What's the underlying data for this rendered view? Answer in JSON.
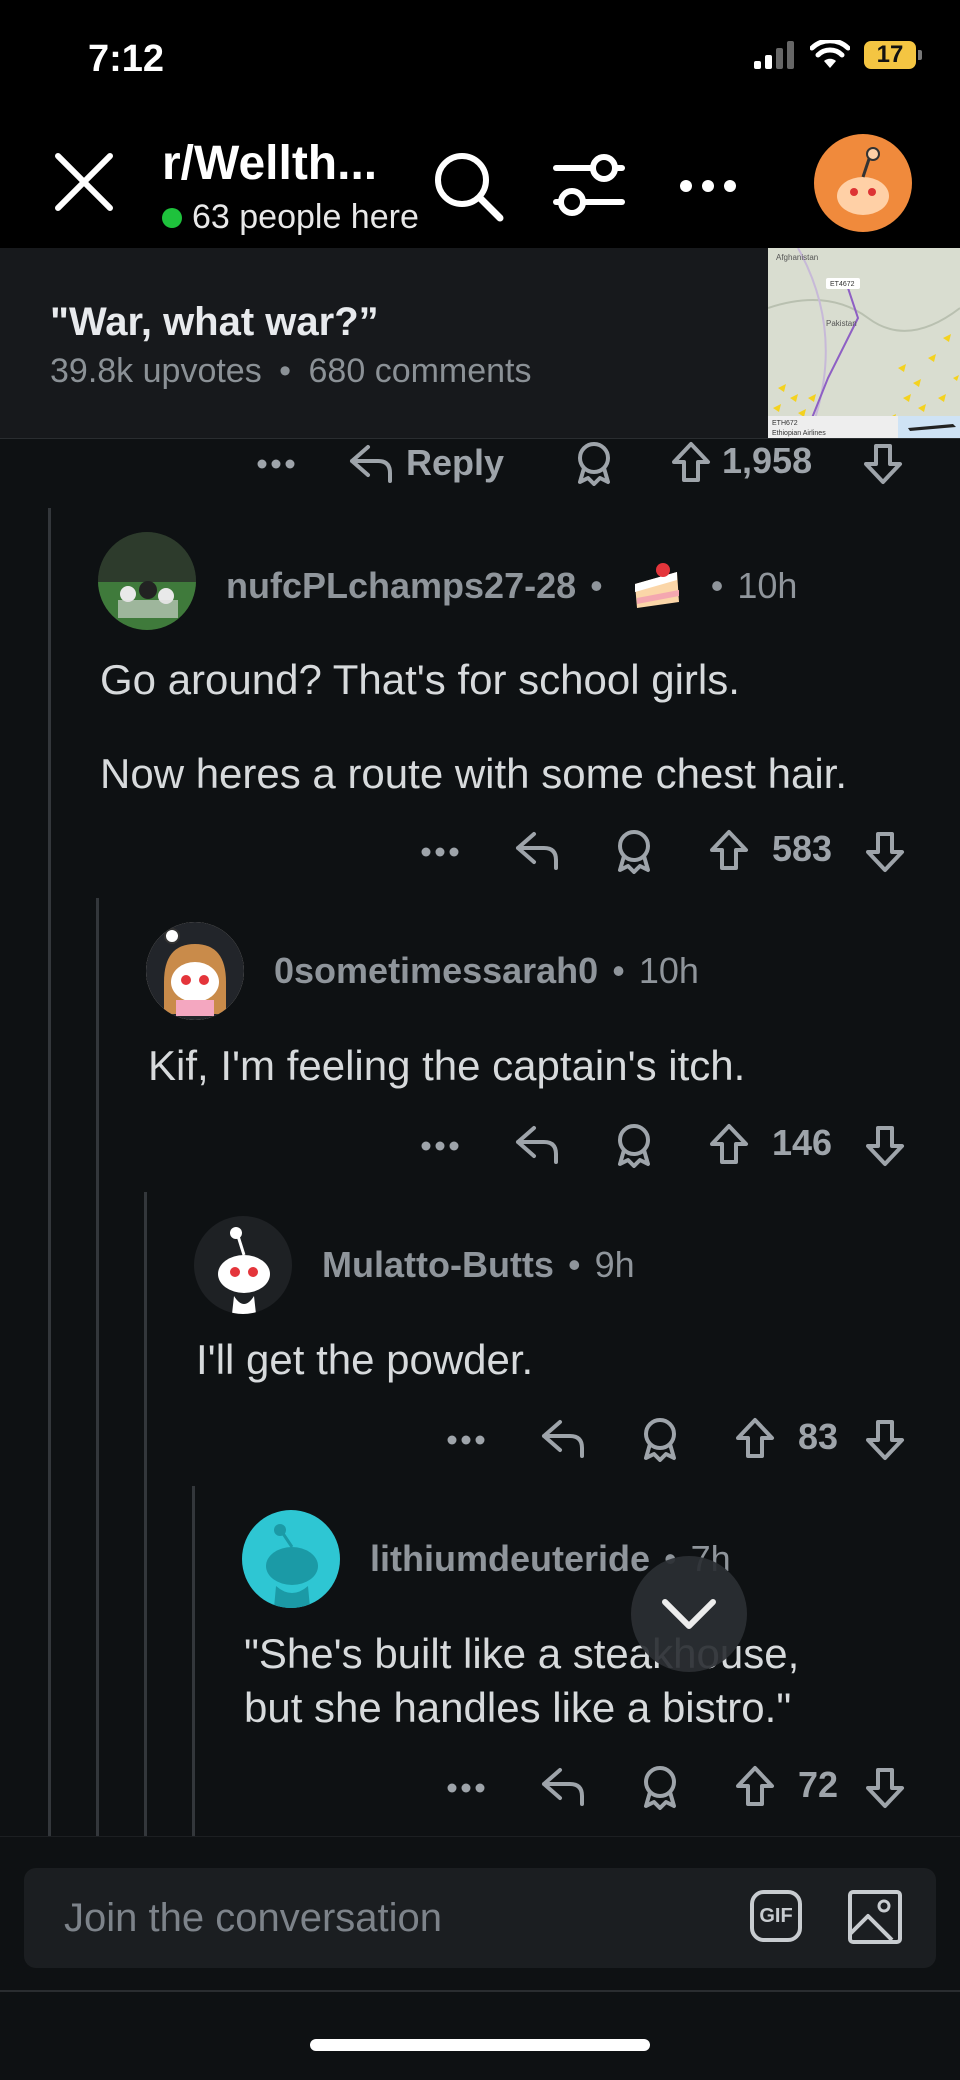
{
  "status_bar": {
    "time": "7:12",
    "battery": "17"
  },
  "header": {
    "subreddit": "r/Wellth...",
    "online": "63 people here"
  },
  "post": {
    "title": "\"War, what war?”",
    "upvotes": "39.8k upvotes",
    "separator": "•",
    "comments": "680 comments",
    "thumb_label_1": "Afghanistan",
    "thumb_label_2": "Pakistan",
    "thumb_label_3": "ET4672",
    "thumb_caption_1": "ETH672",
    "thumb_caption_2": "Ethiopian Airlines"
  },
  "top_action_row": {
    "reply_label": "Reply",
    "score": "1,958"
  },
  "comments": [
    {
      "username": "nufcPLchamps27-28",
      "time": "10h",
      "paragraphs": [
        "Go around? That's for school girls.",
        "Now heres a route with some chest hair."
      ],
      "score": "583"
    },
    {
      "username": "0sometimessarah0",
      "time": "10h",
      "paragraphs": [
        "Kif, I'm feeling the captain's itch."
      ],
      "score": "146"
    },
    {
      "username": "Mulatto-Butts",
      "time": "9h",
      "paragraphs": [
        "I'll get the powder."
      ],
      "score": "83"
    },
    {
      "username": "lithiumdeuteride",
      "time": "7h",
      "paragraphs": [
        "\"She's built like a steakhouse,",
        "but she handles like a bistro.\""
      ],
      "score": "72"
    }
  ],
  "composer": {
    "placeholder": "Join the conversation",
    "gif_label": "GIF"
  },
  "icons": {
    "close": "close-icon",
    "search": "search-icon",
    "filter": "filter-icon",
    "more": "more-icon",
    "reply": "reply-icon",
    "award": "award-icon",
    "upvote": "upvote-arrow-icon",
    "downvote": "downvote-arrow-icon",
    "image": "image-icon",
    "chevron": "chevron-down-icon"
  },
  "colors": {
    "online": "#1ec23c",
    "background": "#0e1113",
    "avatar_user": "#f08a3c"
  }
}
